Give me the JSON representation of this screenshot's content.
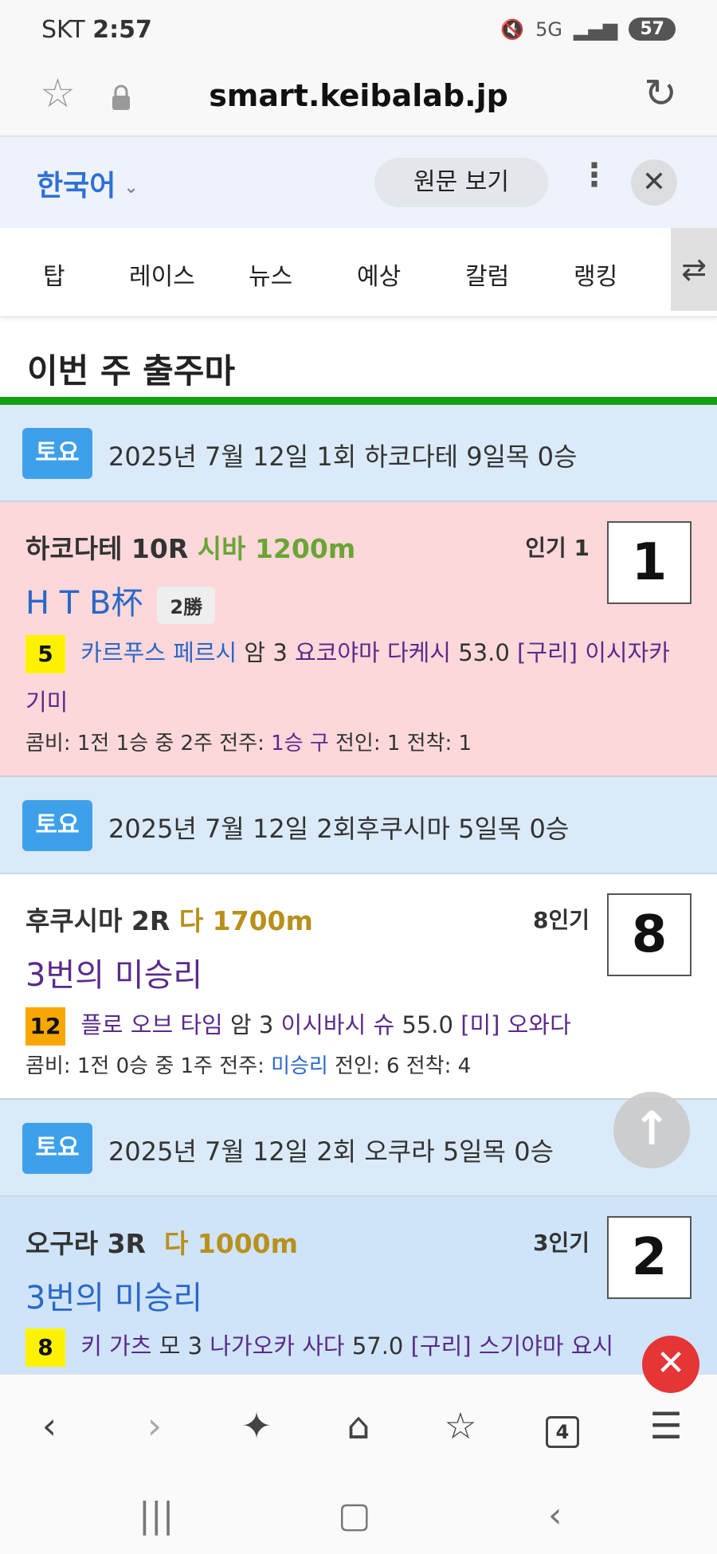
{
  "status_bar": {
    "carrier": "SKT",
    "time": "2:57",
    "battery": "57",
    "network": "5G"
  },
  "browser": {
    "url": "smart.keibalab.jp"
  },
  "translate": {
    "language": "한국어",
    "view_original": "원문 보기"
  },
  "nav": {
    "tabs": [
      "탑",
      "레이스",
      "뉴스",
      "예상",
      "칼럼",
      "랭킹"
    ]
  },
  "section": {
    "title": "이번 주 출주마"
  },
  "days": [
    {
      "badge": "토요",
      "text": "2025년 7월 12일 1회 하코다테 9일목 0승"
    },
    {
      "badge": "토요",
      "text": "2025년 7월 12일 2회후쿠시마 5일목 0승"
    },
    {
      "badge": "토요",
      "text": "2025년 7월 12일 2회 오쿠라 5일목 0승"
    }
  ],
  "races": [
    {
      "place": "하코다테 10R",
      "course": "시바 1200m",
      "popularity": "인기 1",
      "rank": "1",
      "name": "H T B杯",
      "grade": "2勝",
      "horse_no": "5",
      "horse": "카르푸스 페르시",
      "sex_age": "암 3",
      "jockey": "요코야마 다케시",
      "weight": "53.0",
      "stable": "[구리] 이시자카",
      "trainer_cont": "기미",
      "stats_a": "콤비: 1전 1승 중 2주 전주: ",
      "stats_prev": "1승 구",
      "stats_b": " 전인: 1 전착: 1",
      "bg": "#fdd8db"
    },
    {
      "place": "후쿠시마 2R",
      "course": "다 1700m",
      "popularity": "8인기",
      "rank": "8",
      "name": "3번의 미승리",
      "horse_no": "12",
      "horse": "플로 오브 타임",
      "sex_age": "암 3",
      "jockey": "이시바시 슈",
      "weight": "55.0",
      "stable": "[미] 오와다",
      "stats_a": "콤비: 1전 0승 중 1주 전주: ",
      "stats_prev": "미승리",
      "stats_b": " 전인: 6 전착: 4",
      "bg": "#ffffff"
    },
    {
      "place": "오구라 3R",
      "course": "다 1000m",
      "popularity": "3인기",
      "rank": "2",
      "name": "3번의 미승리",
      "horse_no": "8",
      "horse": "키 가츠",
      "sex_age": "모 3",
      "jockey": "나가오카 사다",
      "weight": "57.0",
      "stable": "[구리] 스기야마 요시",
      "bg": "#cfe4f8"
    }
  ],
  "bottom_bar": {
    "tabs_count": "4"
  }
}
